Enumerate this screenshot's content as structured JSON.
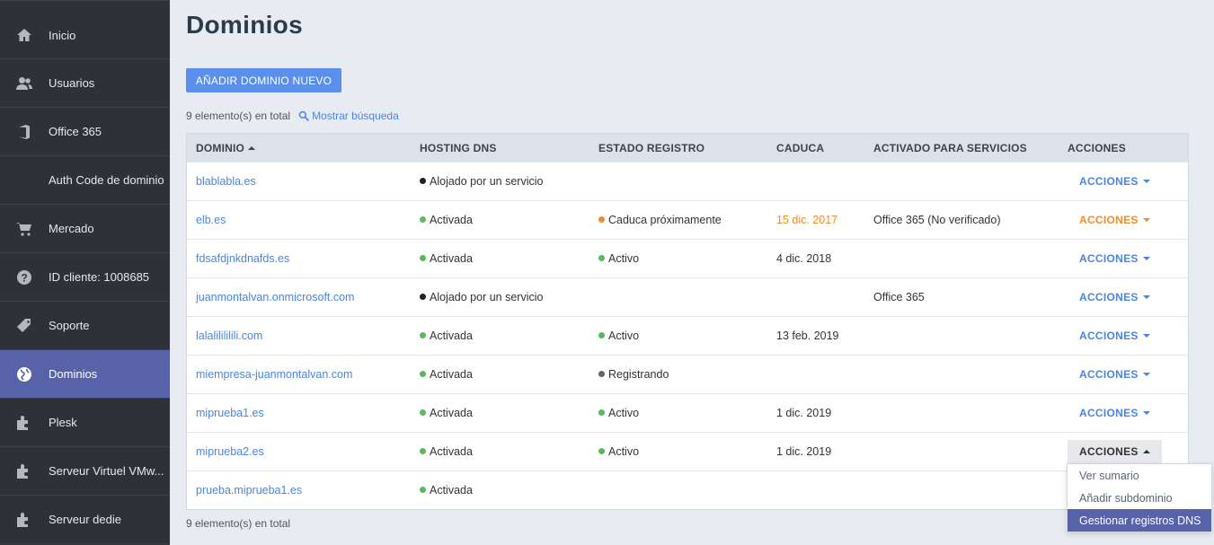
{
  "sidebar": {
    "items": [
      {
        "label": "Inicio",
        "icon": "home-icon"
      },
      {
        "label": "Usuarios",
        "icon": "users-icon"
      },
      {
        "label": "Office 365",
        "icon": "office-icon"
      },
      {
        "label": "Auth Code de dominio",
        "icon": ""
      },
      {
        "label": "Mercado",
        "icon": "cart-icon"
      },
      {
        "label": "ID cliente: 1008685",
        "icon": "help-icon"
      },
      {
        "label": "Soporte",
        "icon": "tag-icon"
      },
      {
        "label": "Dominios",
        "icon": "globe-icon",
        "active": true
      },
      {
        "label": "Plesk",
        "icon": "puzzle-icon"
      },
      {
        "label": "Serveur Virtuel VMw...",
        "icon": "puzzle-icon"
      },
      {
        "label": "Serveur dedie",
        "icon": "puzzle-icon"
      }
    ]
  },
  "page": {
    "title": "Dominios",
    "add_button": "AÑADIR DOMINIO NUEVO",
    "count_top": "9 elemento(s) en total",
    "search_link": "Mostrar búsqueda",
    "count_bottom": "9 elemento(s) en total"
  },
  "table": {
    "headers": {
      "dominio": "DOMINIO",
      "hosting": "HOSTING DNS",
      "estado": "ESTADO REGISTRO",
      "caduca": "CADUCA",
      "servicios": "ACTIVADO PARA SERVICIOS",
      "acciones": "ACCIONES"
    },
    "rows": [
      {
        "dominio": "blablabla.es",
        "hosting": "Alojado por un servicio",
        "hosting_dot": "black",
        "estado": "",
        "estado_dot": "",
        "caduca": "",
        "servicios": "",
        "acciones": "ACCIONES"
      },
      {
        "dominio": "elb.es",
        "hosting": "Activada",
        "hosting_dot": "green",
        "estado": "Caduca próximamente",
        "estado_dot": "orange",
        "caduca": "15 dic. 2017",
        "caduca_warn": true,
        "servicios": "Office 365 (No verificado)",
        "acciones": "ACCIONES",
        "acciones_warn": true
      },
      {
        "dominio": "fdsafdjnkdnafds.es",
        "hosting": "Activada",
        "hosting_dot": "green",
        "estado": "Activo",
        "estado_dot": "green",
        "caduca": "4 dic. 2018",
        "servicios": "",
        "acciones": "ACCIONES"
      },
      {
        "dominio": "juanmontalvan.onmicrosoft.com",
        "hosting": "Alojado por un servicio",
        "hosting_dot": "black",
        "estado": "",
        "estado_dot": "",
        "caduca": "",
        "servicios": "Office 365",
        "acciones": "ACCIONES"
      },
      {
        "dominio": "lalalilililili.com",
        "hosting": "Activada",
        "hosting_dot": "green",
        "estado": "Activo",
        "estado_dot": "green",
        "caduca": "13 feb. 2019",
        "servicios": "",
        "acciones": "ACCIONES"
      },
      {
        "dominio": "miempresa-juanmontalvan.com",
        "hosting": "Activada",
        "hosting_dot": "green",
        "estado": "Registrando",
        "estado_dot": "grey",
        "caduca": "",
        "servicios": "",
        "acciones": "ACCIONES"
      },
      {
        "dominio": "miprueba1.es",
        "hosting": "Activada",
        "hosting_dot": "green",
        "estado": "Activo",
        "estado_dot": "green",
        "caduca": "1 dic. 2019",
        "servicios": "",
        "acciones": "ACCIONES"
      },
      {
        "dominio": "miprueba2.es",
        "hosting": "Activada",
        "hosting_dot": "green",
        "estado": "Activo",
        "estado_dot": "green",
        "caduca": "1 dic. 2019",
        "servicios": "",
        "acciones": "ACCIONES",
        "open": true
      },
      {
        "dominio": "prueba.miprueba1.es",
        "hosting": "Activada",
        "hosting_dot": "green",
        "estado": "",
        "estado_dot": "",
        "caduca": "",
        "servicios": "",
        "acciones": ""
      }
    ]
  },
  "dropdown": {
    "items": [
      {
        "label": "Ver sumario"
      },
      {
        "label": "Añadir subdominio"
      },
      {
        "label": "Gestionar registros DNS",
        "active": true
      }
    ]
  },
  "colors": {
    "sidebar_bg": "#2e3238",
    "active": "#5762a8",
    "link": "#4a86e0",
    "warning": "#f08c28",
    "ok": "#5cb85c",
    "button": "#5b8fec"
  }
}
